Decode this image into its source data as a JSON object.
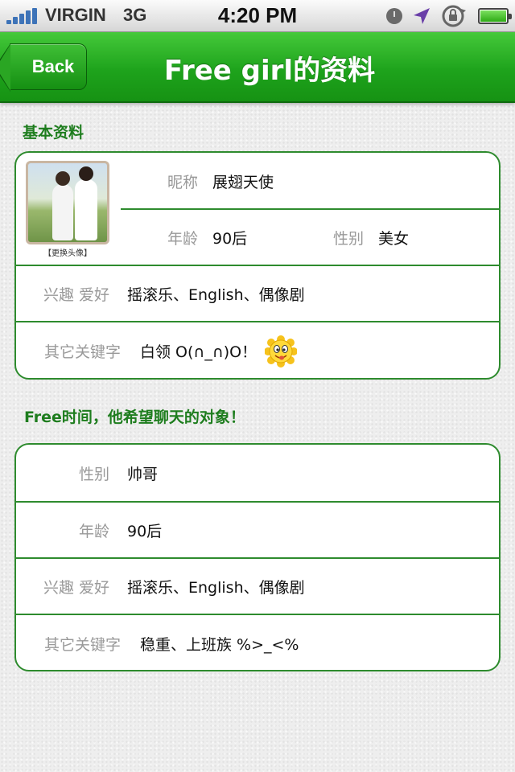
{
  "status_bar": {
    "carrier": "VIRGIN",
    "network": "3G",
    "time": "4:20 PM",
    "icons": [
      "signal-icon",
      "alarm-icon",
      "location-icon",
      "rotation-lock-icon",
      "battery-icon"
    ]
  },
  "nav": {
    "back_label": "Back",
    "title": "Free girl的资料"
  },
  "basic": {
    "section_title": "基本资料",
    "change_avatar": "【更换头像】",
    "nickname_label": "昵称",
    "nickname_value": "展翅天使",
    "age_label": "年龄",
    "age_value": "90后",
    "gender_label": "性别",
    "gender_value": "美女",
    "hobby_label": "兴趣 爱好",
    "hobby_value": "摇滚乐、English、偶像剧",
    "keywords_label": "其它关键字",
    "keywords_value": "白领  O(∩_∩)O！"
  },
  "wish": {
    "section_title": "Free时间，他希望聊天的对象！",
    "gender_label": "性别",
    "gender_value": "帅哥",
    "age_label": "年龄",
    "age_value": "90后",
    "hobby_label": "兴趣 爱好",
    "hobby_value": "摇滚乐、English、偶像剧",
    "keywords_label": "其它关键字",
    "keywords_value": "稳重、上班族 %>_<%"
  },
  "colors": {
    "brand_green": "#1ea31c",
    "border_green": "#2e8b2e",
    "heading_green": "#1e7d1e"
  }
}
